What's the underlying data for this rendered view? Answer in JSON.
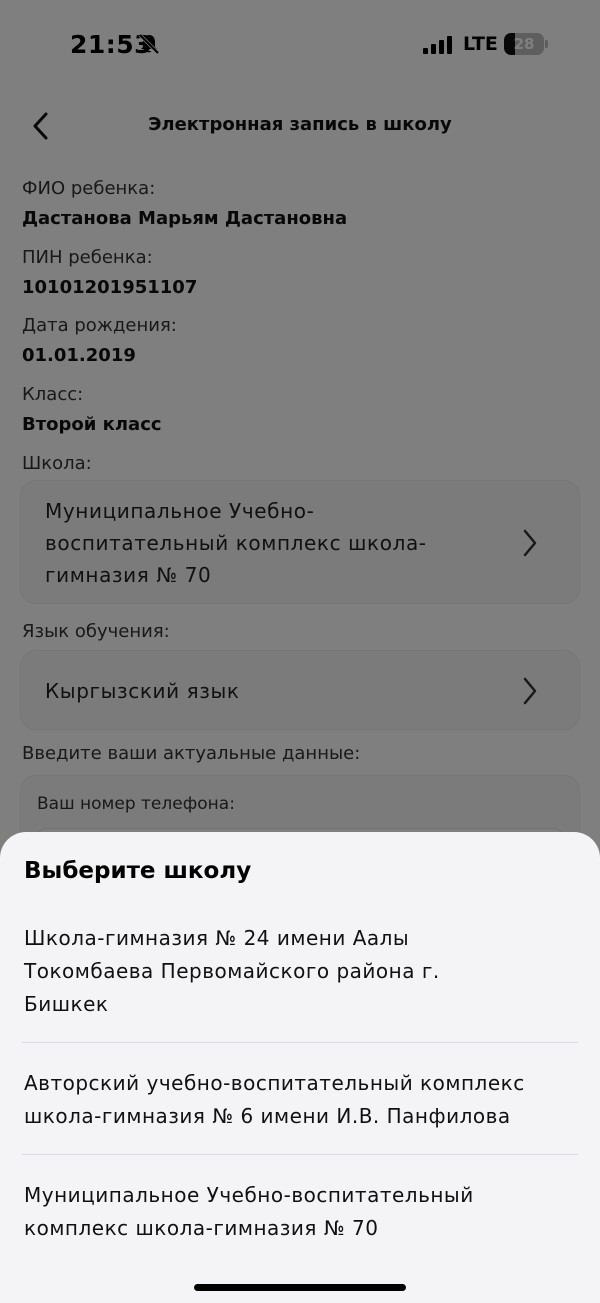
{
  "status": {
    "time": "21:53",
    "network": "LTE",
    "battery_level": 28,
    "battery_text": "28"
  },
  "header": {
    "title": "Электронная запись в школу"
  },
  "form": {
    "child_name_label": "ФИО ребенка:",
    "child_name": "Дастанова Марьям Дастановна",
    "pin_label": "ПИН ребенка:",
    "pin": "10101201951107",
    "birth_label": "Дата рождения:",
    "birth_date": "01.01.2019",
    "class_label": "Класс:",
    "class_value": "Второй класс",
    "school_label": "Школа:",
    "school_lines": [
      "Муниципальное Учебно-",
      "воспитательный комплекс школа-",
      "гимназия № 70"
    ],
    "language_label": "Язык обучения:",
    "language_value": "Кыргызский язык",
    "contact_prompt": "Введите ваши актуальные данные:",
    "phone_label": "Ваш номер телефона:"
  },
  "sheet": {
    "title": "Выберите школу",
    "options": [
      {
        "lines": [
          "Школа-гимназия № 24 имени Аалы",
          "Токомбаева Первомайского района г.",
          "Бишкек"
        ]
      },
      {
        "lines": [
          "Авторский учебно-воспитательный комплекс",
          "школа-гимназия № 6 имени И.В. Панфилова"
        ]
      },
      {
        "lines": [
          "Муниципальное Учебно-воспитательный",
          "комплекс школа-гимназия № 70"
        ]
      }
    ]
  }
}
